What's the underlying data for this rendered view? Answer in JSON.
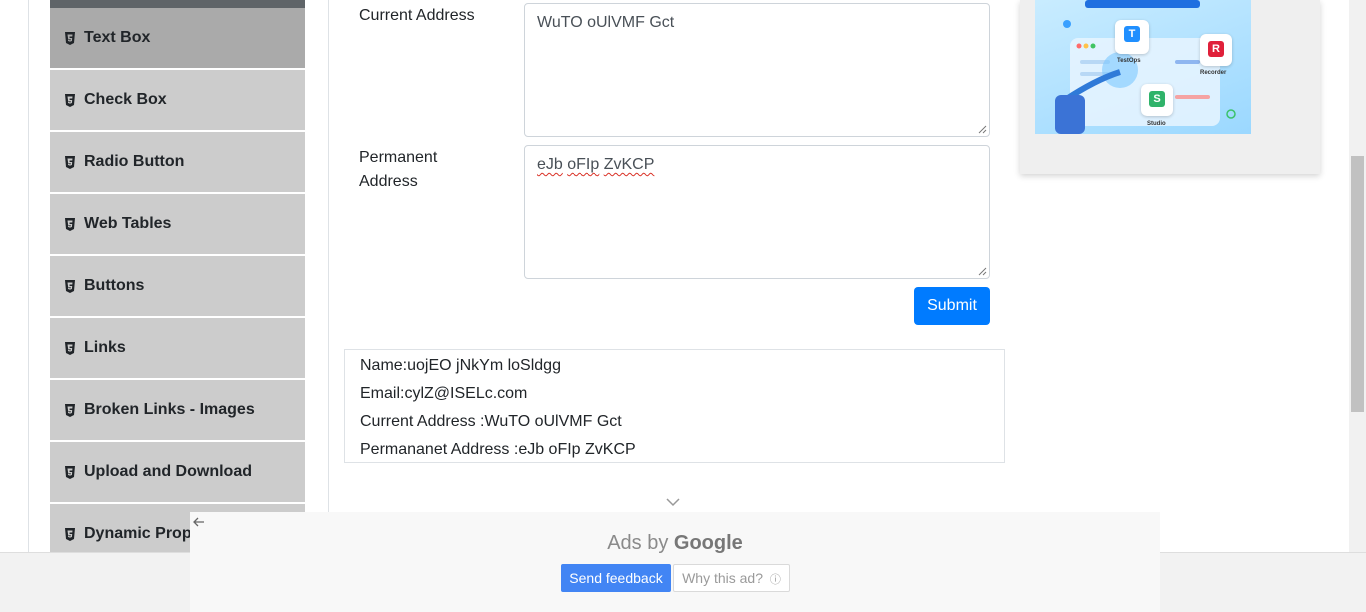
{
  "sidebar": {
    "items": [
      {
        "label": "Text Box",
        "active": true
      },
      {
        "label": "Check Box"
      },
      {
        "label": "Radio Button"
      },
      {
        "label": "Web Tables"
      },
      {
        "label": "Buttons"
      },
      {
        "label": "Links"
      },
      {
        "label": "Broken Links - Images"
      },
      {
        "label": "Upload and Download"
      },
      {
        "label": "Dynamic Properties"
      }
    ]
  },
  "form": {
    "current_address_label": "Current Address",
    "current_address_value": "WuTO oUlVMF Gct",
    "permanent_address_label_line1": "Permanent",
    "permanent_address_label_line2": "Address",
    "permanent_address_words": [
      "eJb",
      "oFIp",
      "ZvKCP"
    ],
    "submit_label": "Submit"
  },
  "output": {
    "name": "Name:uojEO jNkYm loSldgg",
    "email": "Email:cylZ@ISELc.com",
    "current_address": "Current Address :WuTO oUlVMF Gct",
    "permanent_address": "Permananet Address :eJb oFIp ZvKCP"
  },
  "ad_banner": {
    "tiles": [
      "TestOps",
      "Recorder",
      "Studio"
    ],
    "tile_letters": [
      "T",
      "R",
      "S"
    ]
  },
  "google_ad": {
    "ads_by": "Ads by",
    "google": "Google",
    "send_feedback": "Send feedback",
    "why_this_ad": "Why this ad?",
    "info_symbol": "ⓘ"
  },
  "colors": {
    "primary": "#007bff",
    "sidebar_bg": "#cccccc",
    "sidebar_active": "#aaaaaa",
    "google_blue": "#4285f4"
  }
}
